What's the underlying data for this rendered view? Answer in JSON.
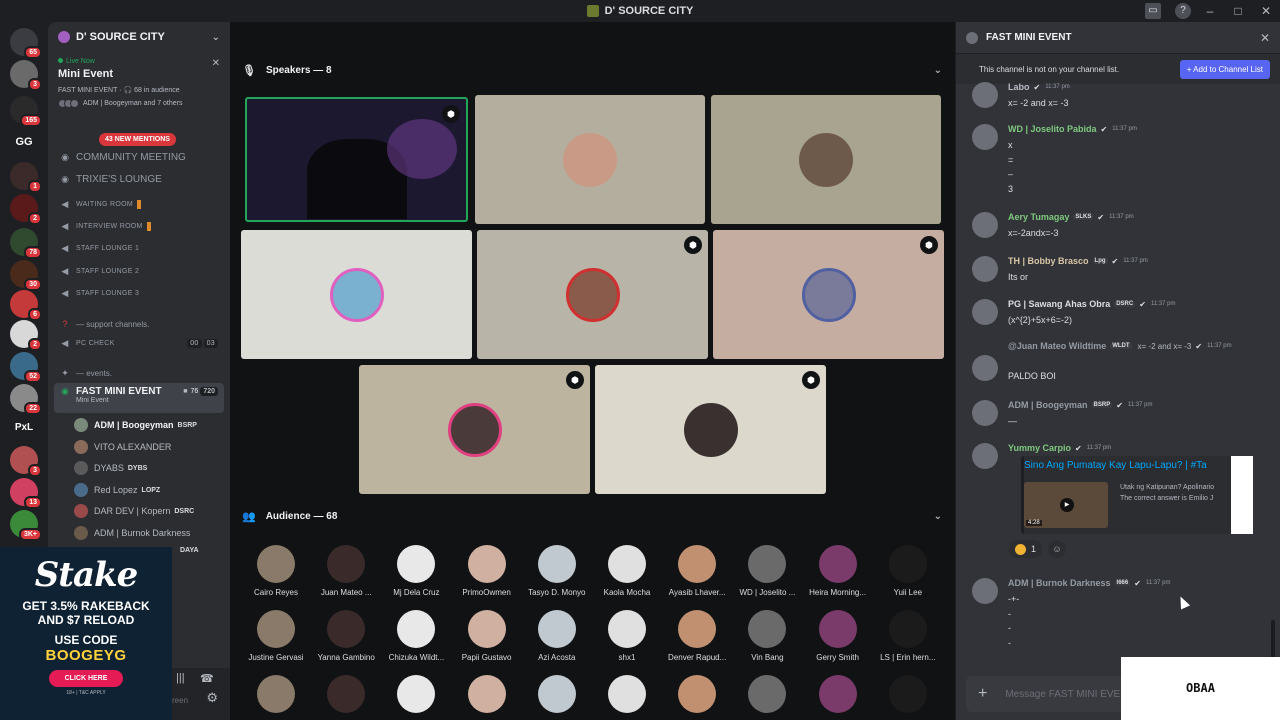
{
  "window": {
    "title": "D' SOURCE CITY"
  },
  "rail": {
    "badges": [
      "65",
      "3",
      "165",
      "",
      "1",
      "2",
      "78",
      "30",
      "6",
      "2",
      "52",
      "22",
      "",
      "3",
      "13",
      "3K+"
    ],
    "text_servers": [
      "GG",
      "PxL"
    ]
  },
  "sidebar": {
    "guild_name": "D' SOURCE CITY",
    "live": {
      "status": "Live Now",
      "title": "Mini Event",
      "sub": "FAST MINI EVENT · 🎧 68 in audience",
      "hosts": "ADM | Boogeyman and 7 others"
    },
    "mentions": "43 NEW MENTIONS",
    "channels": [
      {
        "label": "COMMUNITY MEETING"
      },
      {
        "label": "TRIXIE'S LOUNGE"
      },
      {
        "label": "WAITING ROOM"
      },
      {
        "label": "INTERVIEW ROOM"
      },
      {
        "label": "STAFF LOUNGE 1"
      },
      {
        "label": "STAFF LOUNGE 2"
      },
      {
        "label": "STAFF LOUNGE 3"
      }
    ],
    "category_support": "— support channels.",
    "pc_check": {
      "label": "PC CHECK",
      "count_a": "00",
      "count_b": "03"
    },
    "category_events": "— events.",
    "active_channel": {
      "label": "FAST MINI EVENT",
      "sub": "Mini Event",
      "count_a": "76",
      "count_b": "720"
    },
    "members": [
      {
        "name": "ADM | Boogeyman",
        "tag": "BSRP"
      },
      {
        "name": "VITO ALEXANDER",
        "tag": ""
      },
      {
        "name": "DYABS",
        "tag": "DYBS"
      },
      {
        "name": "Red Lopez",
        "tag": "LOPZ"
      },
      {
        "name": "DAR DEV | Kopern",
        "tag": "DSRC"
      },
      {
        "name": "ADM | Burnok Darkness",
        "tag": ""
      },
      {
        "name": "",
        "tag": "DAYA"
      }
    ],
    "user_bar_hint": "reen"
  },
  "ad": {
    "brand": "Stake",
    "line1": "GET 3.5% RAKEBACK",
    "line1b": "AND $7 RELOAD",
    "line2": "USE CODE",
    "code": "BOOGEYG",
    "cta": "CLICK HERE",
    "tc": "18+ | T&C APPLY"
  },
  "stage": {
    "speakers_header": "Speakers — 8",
    "audience_header": "Audience — 68",
    "speaker_colors": [
      "#1b1830",
      "#b4ae9f",
      "#a8a490",
      "#dcdcd6",
      "#b8b5a8",
      "#c6ada2",
      "#bcb49f",
      "#dcd8cb"
    ],
    "audience": [
      {
        "name": "Cairo Reyes"
      },
      {
        "name": "Juan Mateo ..."
      },
      {
        "name": "Mj Dela Cruz"
      },
      {
        "name": "PrimoOwmen"
      },
      {
        "name": "Tasyo D. Monyo"
      },
      {
        "name": "Kaola Mocha"
      },
      {
        "name": "Ayasib Lhaver..."
      },
      {
        "name": "WD | Joselito ..."
      },
      {
        "name": "Heira Morning..."
      },
      {
        "name": "Yuii Lee"
      },
      {
        "name": "Justine Gervasi"
      },
      {
        "name": "Yanna Gambino"
      },
      {
        "name": "Chizuka Wildt..."
      },
      {
        "name": "Papii Gustavo"
      },
      {
        "name": "Azi Acosta"
      },
      {
        "name": "shx1"
      },
      {
        "name": "Denver Rapud..."
      },
      {
        "name": "Vin Bang"
      },
      {
        "name": "Gerry Smith"
      },
      {
        "name": "LS | Erin hern..."
      },
      {
        "name": ""
      },
      {
        "name": ""
      },
      {
        "name": ""
      },
      {
        "name": ""
      },
      {
        "name": ""
      },
      {
        "name": ""
      },
      {
        "name": ""
      },
      {
        "name": ""
      },
      {
        "name": ""
      },
      {
        "name": ""
      }
    ]
  },
  "chat": {
    "title": "FAST MINI EVENT",
    "notice": "This channel is not on your channel list.",
    "add_button": "Add to Channel List",
    "messages": [
      {
        "name": "Labo",
        "badge": "",
        "time": "11:37 pm",
        "body": "x= -2 and x= -3",
        "color": "#b5bac1"
      },
      {
        "name": "WD | Joselito Pabida",
        "badge": "",
        "time": "11:37 pm",
        "body": "x\n=\n–\n3",
        "color": "#7fc97f"
      },
      {
        "name": "Aery Tumagay",
        "badge": "SLKS",
        "time": "11:37 pm",
        "body": "x=-2andx=-3",
        "color": "#7fc97f"
      },
      {
        "name": "TH | Bobby Brasco",
        "badge": "Lpg",
        "time": "11:37 pm",
        "body": "Its or",
        "color": "#d8c6a6"
      },
      {
        "name": "PG | Sawang Ahas Obra",
        "badge": "DSRC",
        "time": "11:37 pm",
        "body": "(x^{2}+5x+6=-2)",
        "color": "#dbdee1"
      },
      {
        "name": "@Juan Mateo Wildtime",
        "badge": "WLDT",
        "time": "11:37 pm",
        "body": "PALDO BOI",
        "reply": "x= -2 and x= -3",
        "color": "#949ba4"
      },
      {
        "name": "ADM | Boogeyman",
        "badge": "BSRP",
        "time": "11:37 pm",
        "body": "—",
        "color": "#949ba4"
      },
      {
        "name": "Yummy Carpio",
        "badge": "",
        "time": "11:37 pm",
        "body": "",
        "color": "#7fc97f"
      },
      {
        "name": "ADM | Burnok Darkness",
        "badge": "I666",
        "time": "11:37 pm",
        "body": "-+-\n-\n-\n-",
        "color": "#949ba4"
      }
    ],
    "embed": {
      "title": "Sino Ang Pumatay Kay Lapu-Lapu? | #Ta",
      "desc1": "Utak ng Katipunan? Apolinario",
      "desc2": "The correct answer is Emilio J",
      "duration": "4:28"
    },
    "reaction_count": "1",
    "composer_placeholder": "Message FAST MINI EVENT"
  },
  "overlay": {
    "obs_text": "OBAA"
  }
}
